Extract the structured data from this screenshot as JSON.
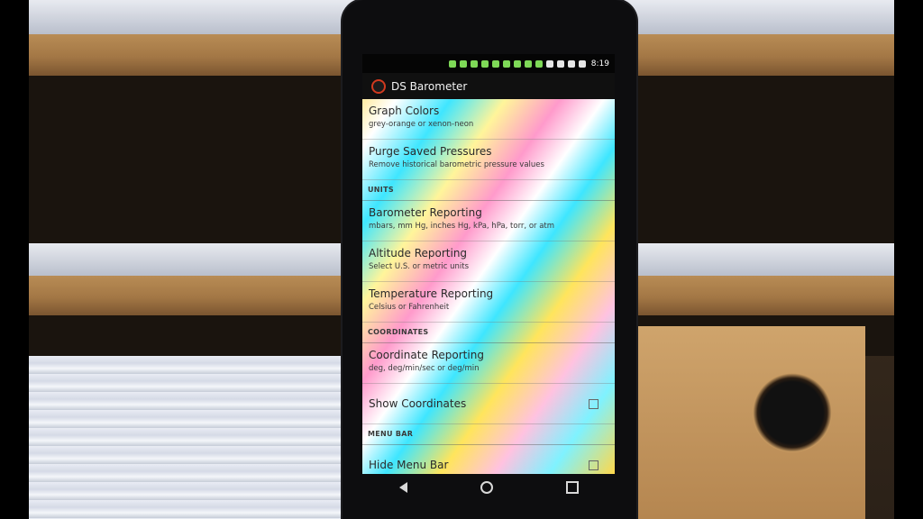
{
  "status_bar": {
    "time": "8:19"
  },
  "app": {
    "title": "DS Barometer"
  },
  "items": {
    "graph_colors": {
      "title": "Graph Colors",
      "summary": "grey-orange or xenon-neon"
    },
    "purge": {
      "title": "Purge Saved Pressures",
      "summary": "Remove historical barometric pressure values"
    },
    "units_header": "UNITS",
    "barometer": {
      "title": "Barometer Reporting",
      "summary": "mbars, mm Hg, inches Hg, kPa, hPa, torr, or atm"
    },
    "altitude": {
      "title": "Altitude Reporting",
      "summary": "Select U.S. or metric units"
    },
    "temperature": {
      "title": "Temperature Reporting",
      "summary": "Celsius or Fahrenheit"
    },
    "coordinates_header": "COORDINATES",
    "coordinate": {
      "title": "Coordinate Reporting",
      "summary": "deg, deg/min/sec or deg/min"
    },
    "show_coordinates": {
      "title": "Show Coordinates",
      "checked": false
    },
    "menubar_header": "MENU BAR",
    "hide_menu_bar": {
      "title": "Hide Menu Bar",
      "checked": false
    }
  },
  "icons": {
    "status": [
      "notification-icon",
      "facebook-icon",
      "timer-icon",
      "wrench-icon",
      "facebook-icon",
      "alarm-icon",
      "photo-icon",
      "smile-icon",
      "coin-icon",
      "bluetooth-icon",
      "alarm-icon",
      "wifi-icon",
      "battery-icon"
    ],
    "nav": [
      "back-icon",
      "home-icon",
      "recents-icon"
    ]
  },
  "colors": {
    "accent": "#d13a1f",
    "action_bar": "#101010"
  }
}
